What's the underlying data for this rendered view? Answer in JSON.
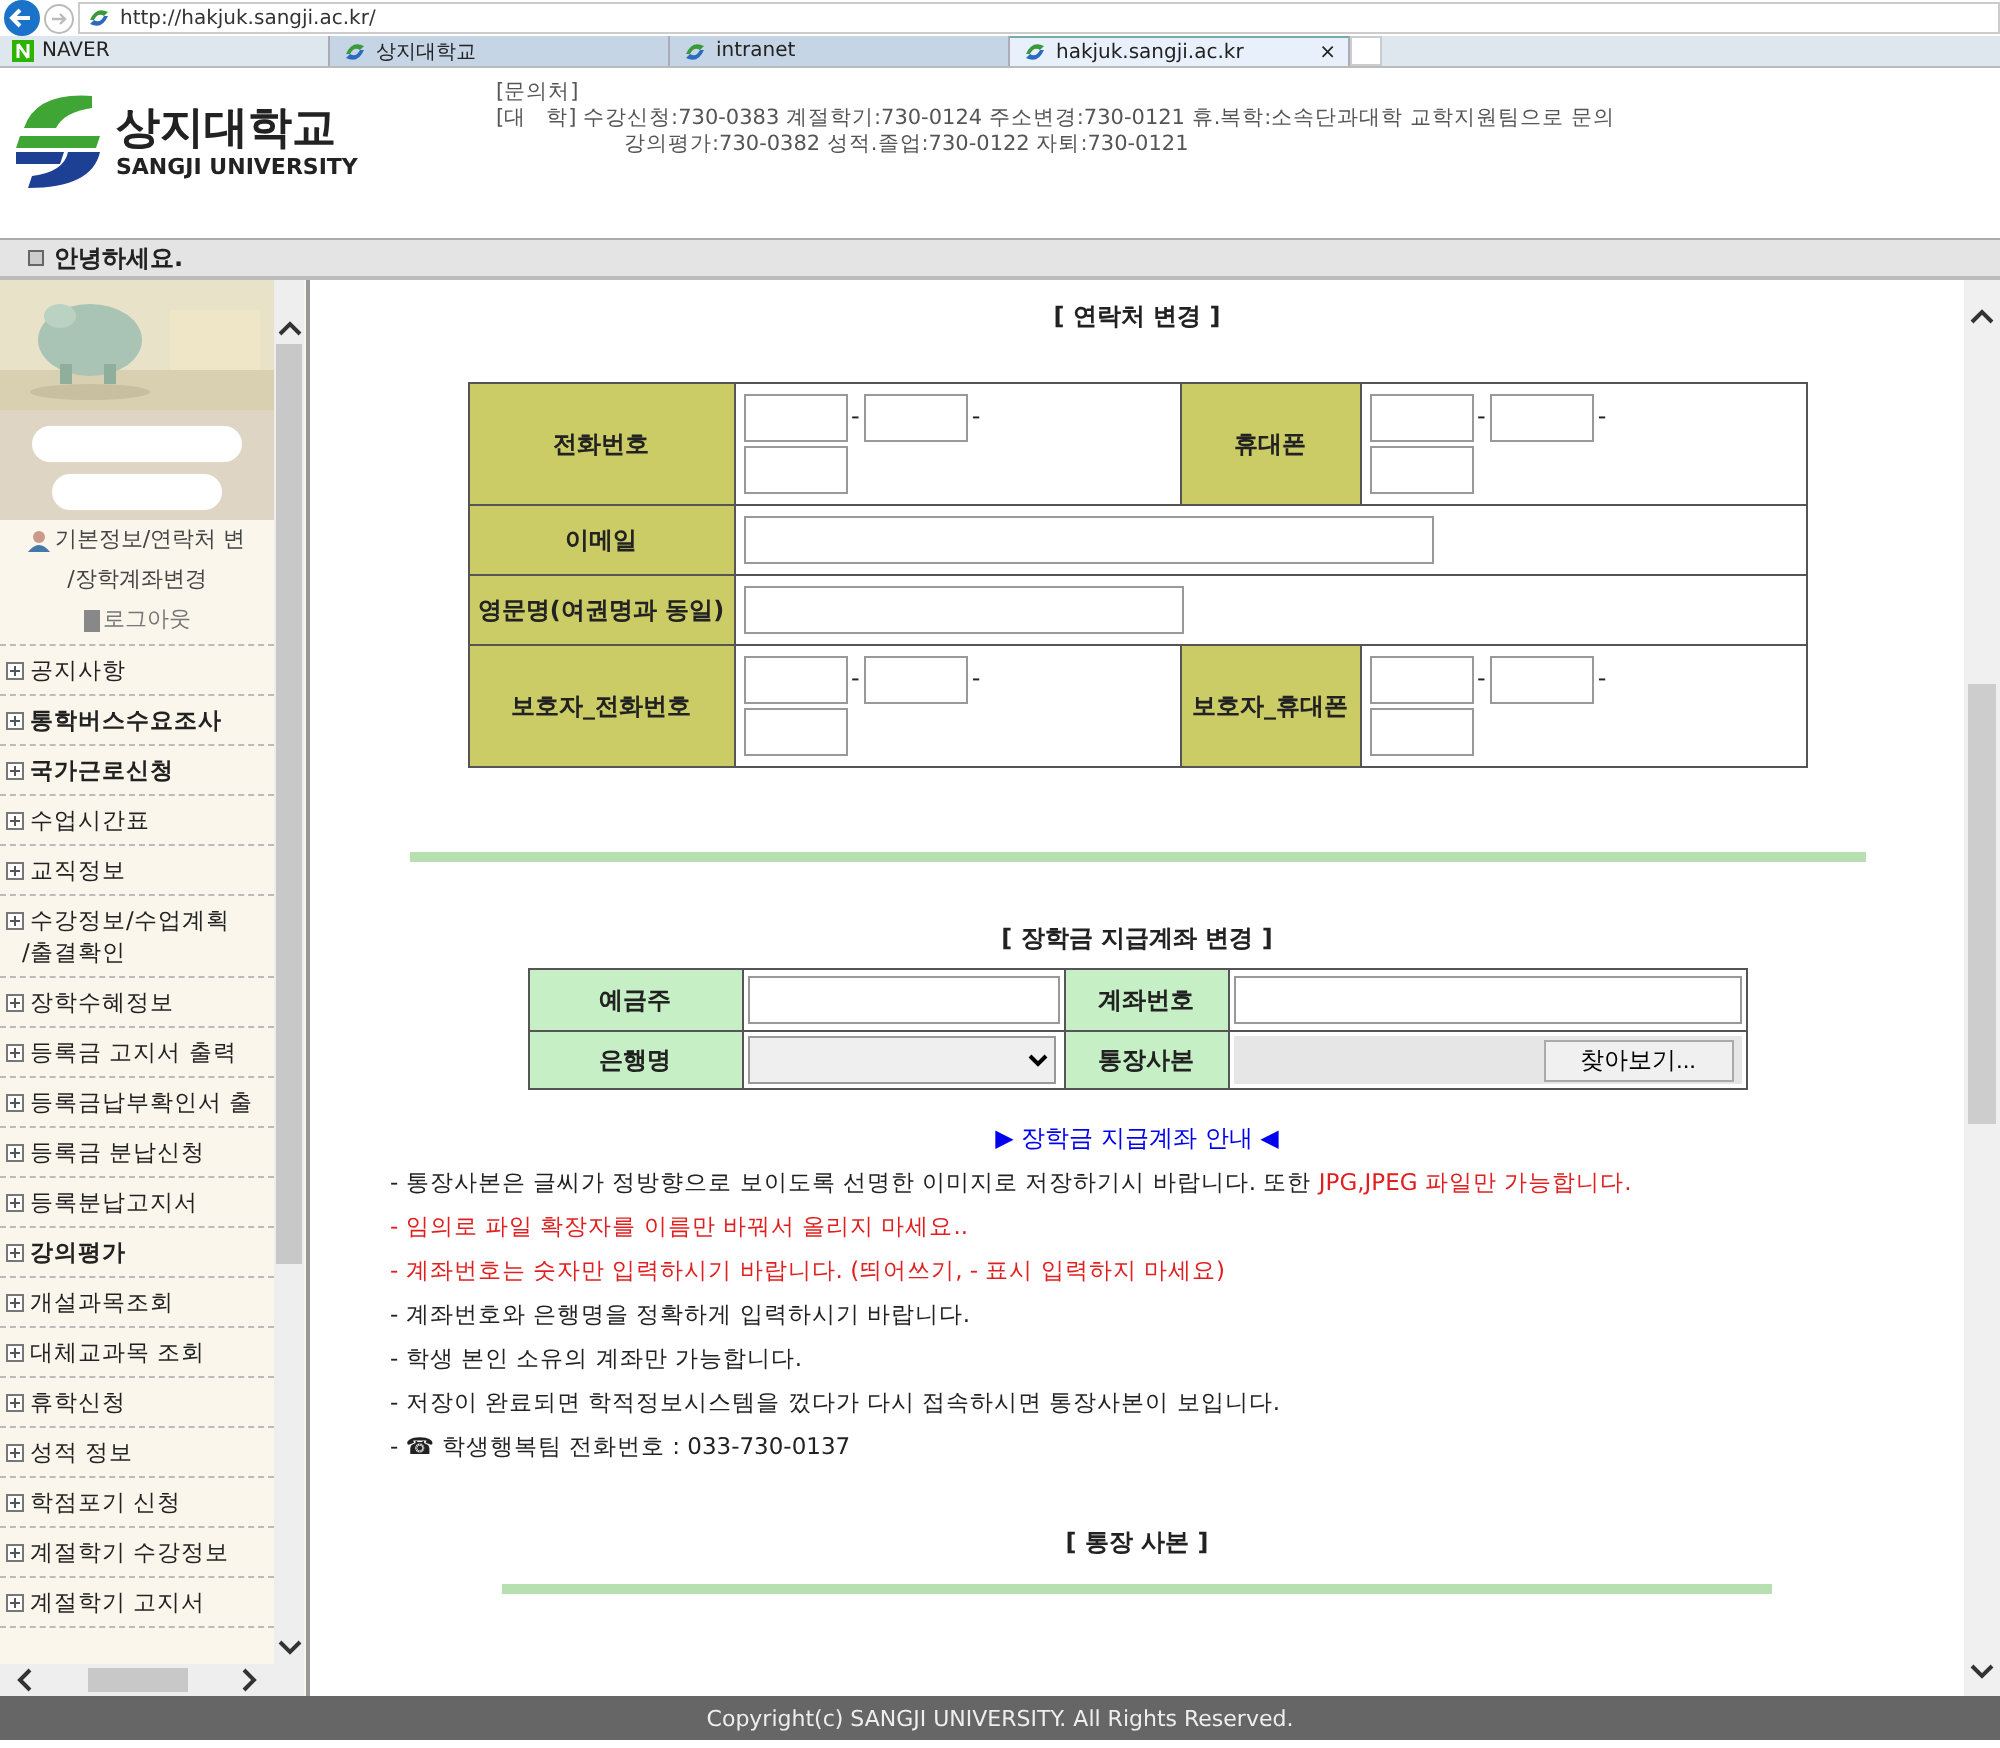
{
  "browser": {
    "url": "http://hakjuk.sangji.ac.kr/",
    "tabs": [
      {
        "label": "NAVER",
        "kind": "favorite",
        "selected": false
      },
      {
        "label": "상지대학교",
        "kind": "tab",
        "selected": false
      },
      {
        "label": "intranet",
        "kind": "tab",
        "selected": false
      },
      {
        "label": "hakjuk.sangji.ac.kr",
        "kind": "tab",
        "selected": true,
        "close": "×"
      }
    ]
  },
  "header": {
    "logo_name": "상지대학교",
    "logo_sub": "SANGJI UNIVERSITY",
    "contact": [
      "[문의처]",
      "[대   학] 수강신청:730-0383 계절학기:730-0124 주소변경:730-0121 휴.복학:소속단과대학 교학지원팀으로 문의",
      "강의평가:730-0382 성적.졸업:730-0122 자퇴:730-0121"
    ]
  },
  "greeting": "안녕하세요.",
  "sidebar": {
    "banner": {
      "kind": "picture"
    },
    "user_menu": [
      "기본정보/연락처 변",
      "/장학계좌변경"
    ],
    "logout": "로그아웃",
    "items": [
      {
        "label": "공지사항",
        "bold": false
      },
      {
        "label": "통학버스수요조사",
        "bold": true
      },
      {
        "label": "국가근로신청",
        "bold": true
      },
      {
        "label": "수업시간표",
        "bold": false
      },
      {
        "label": "교직정보",
        "bold": false
      },
      {
        "label": "수강정보/수업계획",
        "bold": false,
        "extra": "/출결확인"
      },
      {
        "label": "장학수혜정보",
        "bold": false
      },
      {
        "label": "등록금 고지서 출력",
        "bold": false
      },
      {
        "label": "등록금납부확인서 출",
        "bold": false
      },
      {
        "label": "등록금 분납신청",
        "bold": false
      },
      {
        "label": "등록분납고지서",
        "bold": false
      },
      {
        "label": "강의평가",
        "bold": true
      },
      {
        "label": "개설과목조회",
        "bold": false
      },
      {
        "label": "대체교과목 조회",
        "bold": false
      },
      {
        "label": "휴학신청",
        "bold": false
      },
      {
        "label": "성적 정보",
        "bold": false
      },
      {
        "label": "학점포기 신청",
        "bold": false
      },
      {
        "label": "계절학기 수강정보",
        "bold": false
      },
      {
        "label": "계절학기 고지서",
        "bold": false
      }
    ]
  },
  "contact_form": {
    "title": "[ 연락처 변경 ]",
    "separator": "-",
    "rows": [
      [
        {
          "label": "전화번호",
          "kind": "phone"
        },
        {
          "label": "휴대폰",
          "kind": "phone"
        }
      ],
      [
        {
          "label": "이메일",
          "kind": "long"
        }
      ],
      [
        {
          "label": "영문명(여권명과 동일)",
          "kind": "medium"
        }
      ],
      [
        {
          "label": "보호자_전화번호",
          "kind": "phone"
        },
        {
          "label": "보호자_휴대폰",
          "kind": "phone"
        }
      ]
    ]
  },
  "account_form": {
    "title": "[ 장학금 지급계좌 변경 ]",
    "rows": [
      [
        {
          "label": "예금주",
          "kind": "text"
        },
        {
          "label": "계좌번호",
          "kind": "text"
        }
      ],
      [
        {
          "label": "은행명",
          "kind": "select"
        },
        {
          "label": "통장사본",
          "kind": "file",
          "button": "찾아보기..."
        }
      ]
    ]
  },
  "guide_link": "▶ 장학금 지급계좌 안내 ◀",
  "notes": [
    {
      "parts": [
        {
          "text": "- 통장사본은 글씨가 정방향으로 보이도록 선명한 이미지로 저장하기시 바랍니다. 또한 ",
          "warning": false
        },
        {
          "text": "JPG,JPEG 파일만 가능합니다.",
          "warning": true
        }
      ]
    },
    {
      "parts": [
        {
          "text": "- 임의로 파일 확장자를 이름만 바꿔서 올리지 마세요..",
          "warning": true
        }
      ]
    },
    {
      "parts": [
        {
          "text": "- 계좌번호는 숫자만 입력하시기 바랍니다. (띄어쓰기, - 표시 입력하지 마세요)",
          "warning": true
        }
      ]
    },
    {
      "parts": [
        {
          "text": "- 계좌번호와 은행명을 정확하게 입력하시기 바랍니다.",
          "warning": false
        }
      ]
    },
    {
      "parts": [
        {
          "text": "- 학생 본인 소유의 계좌만 가능합니다.",
          "warning": false
        }
      ]
    },
    {
      "parts": [
        {
          "text": "- 저장이 완료되면 학적정보시스템을 껐다가 다시 접속하시면 통장사본이 보입니다.",
          "warning": false
        }
      ]
    },
    {
      "parts": [
        {
          "text": "- ☎ 학생행복팀 전화번호 : 033-730-0137",
          "warning": false
        }
      ]
    }
  ],
  "copy_title": "[ 통장 사본 ]",
  "footer": "Copyright(c) SANGJI UNIVERSITY. All Rights Reserved."
}
